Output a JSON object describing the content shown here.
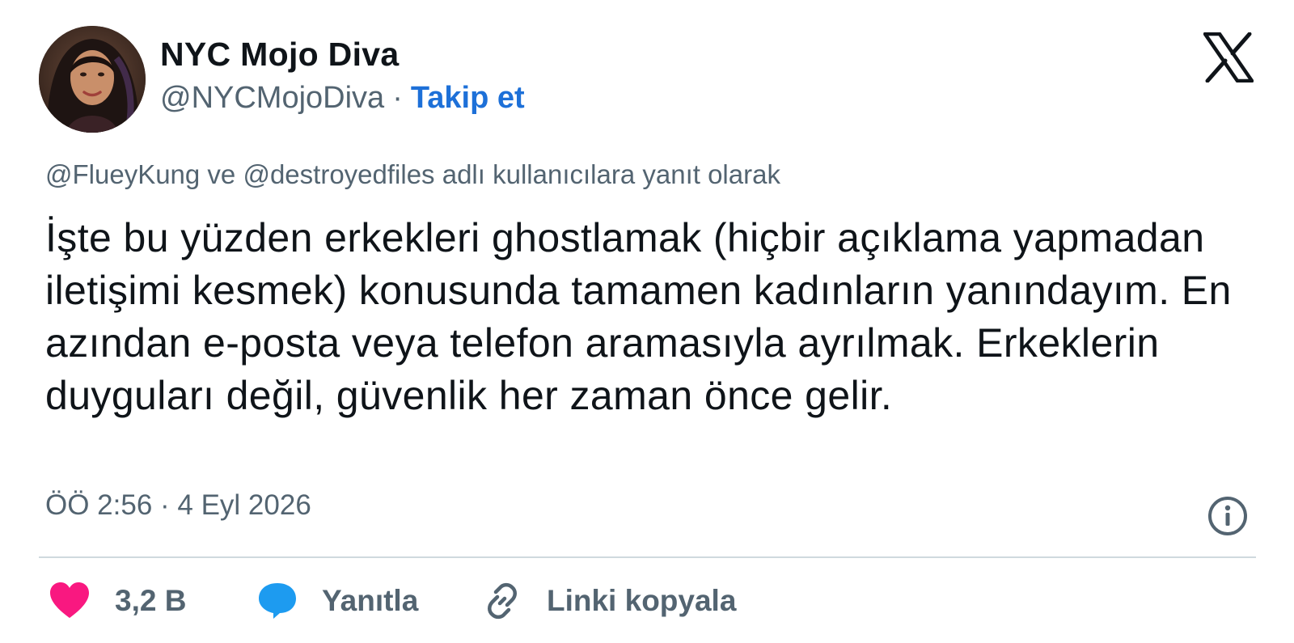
{
  "author": {
    "display_name": "NYC Mojo Diva",
    "handle": "@NYCMojoDiva",
    "separator": "·",
    "follow_label": "Takip et"
  },
  "brand": {
    "logo_icon": "x-logo-icon"
  },
  "tweet": {
    "reply_context": "@FlueyKung ve @destroyedfiles adlı kullanıcılara yanıt olarak",
    "text": "İşte bu yüzden erkekleri ghostlamak (hiçbir açıklama yapmadan iletişimi kesmek) konusunda tamamen kadınların yanındayım. En azından e-posta veya telefon aramasıyla ayrılmak. Erkeklerin duyguları değil, güvenlik her zaman önce gelir.",
    "timestamp": "ÖÖ 2:56 · 4 Eyl 2026"
  },
  "actions": {
    "like": {
      "icon": "heart-icon",
      "label": "3,2 B",
      "color": "#f91880"
    },
    "reply": {
      "icon": "reply-bubble-icon",
      "label": "Yanıtla",
      "color": "#1d9bf0"
    },
    "copy_link": {
      "icon": "link-icon",
      "label": "Linki kopyala",
      "color": "#536471"
    },
    "info": {
      "icon": "info-icon"
    }
  },
  "colors": {
    "accent": "#1d70d8",
    "muted": "#536471",
    "divider": "#cfd9de"
  }
}
